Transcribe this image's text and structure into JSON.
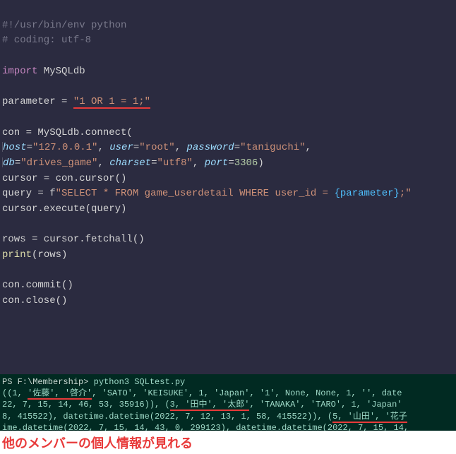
{
  "code": {
    "shebang": "#!/usr/bin/env python",
    "coding": "# coding: utf-8",
    "import_kw": "import",
    "import_mod": " MySQLdb",
    "param_var": "parameter ",
    "param_eq": "= ",
    "param_val": "\"1 OR 1 = 1;\"",
    "con_line": "con = MySQLdb.connect(",
    "host_k": "host",
    "host_v": "\"127.0.0.1\"",
    "user_k": "user",
    "user_v": "\"root\"",
    "password_k": "password",
    "password_v": "\"taniguchi\"",
    "db_k": "db",
    "db_v": "\"drives_game\"",
    "charset_k": "charset",
    "charset_v": "\"utf8\"",
    "port_k": "port",
    "port_v": "3306",
    "cursor_line": "cursor = con.cursor()",
    "query_a": "query = f",
    "query_b": "\"SELECT * FROM game_userdetail WHERE user_id = ",
    "query_c": "{parameter}",
    "query_d": ";\"",
    "execute_line": "cursor.execute(query)",
    "rows_line": "rows = cursor.fetchall()",
    "print_kw": "print",
    "print_arg": "(rows)",
    "commit_line": "con.commit()",
    "close_line": "con.close()"
  },
  "terminal": {
    "prompt": "PS F:\\Membership> ",
    "cmd": "python3 SQLtest.py",
    "out1a": "((1, ",
    "out1b": "'佐藤', '啓介'",
    "out1c": ", 'SATO', 'KEISUKE', 1, 'Japan', '1', None, None, 1, '', date",
    "out2a": "22, 7, 15, 14, 46, 53, 35916)), (",
    "out2b": "3, '田中', '太郎'",
    "out2c": ", 'TANAKA', 'TARO', 1, 'Japan'",
    "out3a": "8, 415522), datetime.datetime(2022, 7, 12, 13, 1, 58, 415522)), (",
    "out3b": "5, '山田', '花子",
    "out4": "ime.datetime(2022, 7, 15, 14, 43, 0, 299123), datetime.datetime(2022, 7, 15, 14,"
  },
  "caption": "他のメンバーの個人情報が見れる"
}
